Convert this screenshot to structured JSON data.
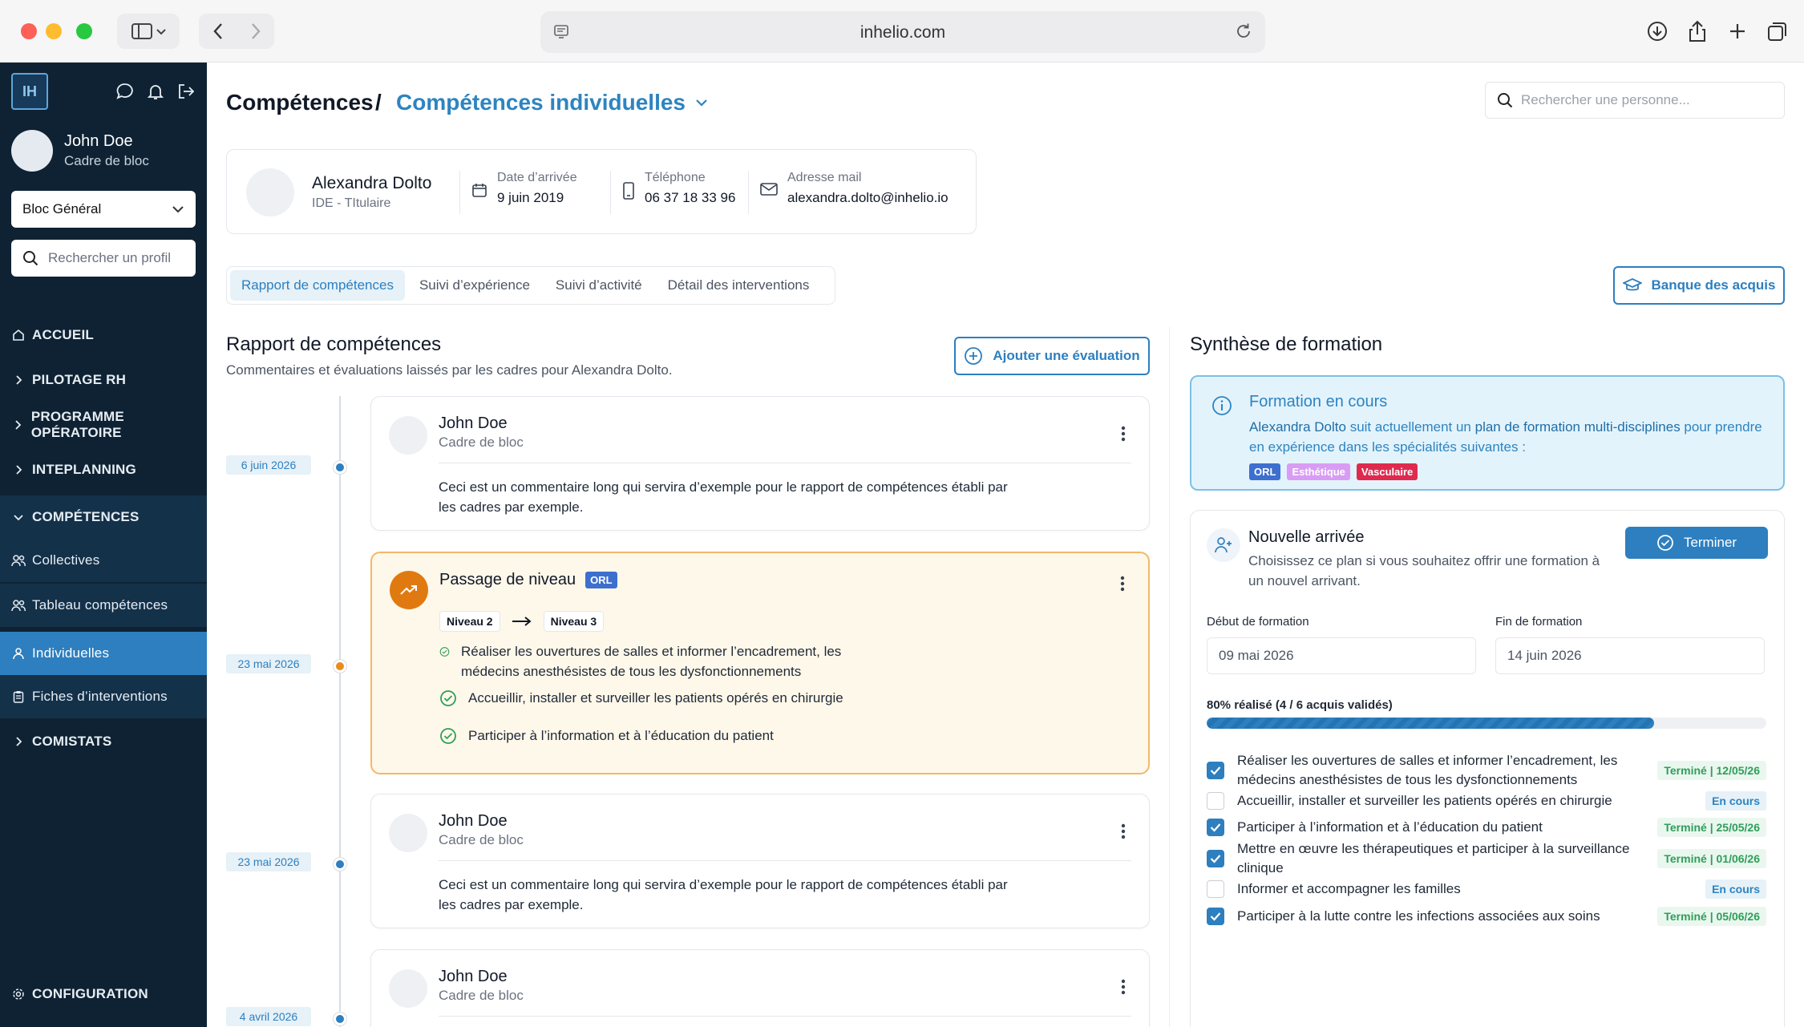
{
  "browser": {
    "url": "inhelio.com"
  },
  "sidebar": {
    "logo": "IH",
    "user": {
      "name": "John Doe",
      "role": "Cadre de bloc"
    },
    "bloc_select": "Bloc Général",
    "search_placeholder": "Rechercher un profil",
    "nav": [
      {
        "label": "ACCUEIL",
        "icon": "home-icon"
      },
      {
        "label": "PILOTAGE RH",
        "icon": "chevron-right-icon"
      },
      {
        "label": "PROGRAMME OPÉRATOIRE",
        "icon": "chevron-right-icon"
      },
      {
        "label": "INTEPLANNING",
        "icon": "chevron-right-icon"
      },
      {
        "label": "COMPÉTENCES",
        "icon": "chevron-down-icon"
      },
      {
        "label": "Collectives",
        "icon": "users-icon"
      },
      {
        "label": "Tableau compétences",
        "icon": "users-icon"
      },
      {
        "label": "Individuelles",
        "icon": "user-icon"
      },
      {
        "label": "Fiches d’interventions",
        "icon": "clipboard-icon"
      },
      {
        "label": "COMISTATS",
        "icon": "chevron-right-icon"
      }
    ],
    "config": "CONFIGURATION"
  },
  "header": {
    "crumb_root": "Compétences",
    "crumb_sep": "/",
    "crumb_current": "Compétences individuelles",
    "search_placeholder": "Rechercher une personne..."
  },
  "profile": {
    "name": "Alexandra Dolto",
    "role": "IDE - TItulaire",
    "arrival_label": "Date d’arrivée",
    "arrival_value": "9 juin 2019",
    "phone_label": "Téléphone",
    "phone_value": "06 37 18 33 96",
    "email_label": "Adresse mail",
    "email_value": "alexandra.dolto@inhelio.io"
  },
  "tabs": [
    {
      "label": "Rapport de compétences"
    },
    {
      "label": "Suivi d’expérience"
    },
    {
      "label": "Suivi d’activité"
    },
    {
      "label": "Détail des interventions"
    }
  ],
  "banque_label": "Banque des acquis",
  "report": {
    "title": "Rapport de compétences",
    "subtitle": "Commentaires et évaluations laissés par les cadres pour Alexandra Dolto.",
    "add_label": "Ajouter une évaluation",
    "dates": [
      "6 juin 2026",
      "23 mai 2026",
      "23 mai 2026",
      "4 avril 2026"
    ],
    "comments": [
      {
        "name": "John Doe",
        "role": "Cadre de bloc",
        "text": "Ceci est un commentaire long qui servira d’exemple pour le rapport de compétences établi par les cadres par exemple."
      },
      {
        "name": "John Doe",
        "role": "Cadre de bloc",
        "text": "Ceci est un commentaire long qui servira d’exemple pour le rapport de compétences établi par les cadres par exemple."
      },
      {
        "name": "John Doe",
        "role": "Cadre de bloc"
      }
    ],
    "level_up": {
      "title": "Passage de niveau",
      "tag": "ORL",
      "from": "Niveau 2",
      "to": "Niveau 3",
      "items": [
        "Réaliser les ouvertures de salles et informer l’encadrement, les médecins anesthésistes de tous les dysfonctionnements",
        "Accueillir, installer et surveiller les patients opérés en chirurgie",
        "Participer à l’information et à l’éducation du patient"
      ]
    }
  },
  "synthese": {
    "title": "Synthèse de formation",
    "info": {
      "title": "Formation en cours",
      "name": "Alexandra Dolto",
      "text_mid": " suit actuellement un ",
      "plan": "plan de formation multi-disciplines",
      "text_end": " pour prendre en expérience dans les spécialités suivantes :",
      "tags": [
        "ORL",
        "Esthétique",
        "Vasculaire"
      ]
    },
    "plan": {
      "title": "Nouvelle arrivée",
      "subtitle": "Choisissez ce plan si vous souhaitez offrir une formation à un nouvel arrivant.",
      "button": "Terminer",
      "start_label": "Début de formation",
      "start_value": "09 mai 2026",
      "end_label": "Fin de formation",
      "end_value": "14 juin 2026",
      "progress_label": "80% réalisé (4 / 6 acquis validés)",
      "progress": 0.8,
      "tasks": [
        {
          "text": "Réaliser les ouvertures de salles et informer l’encadrement, les médecins anesthésistes de tous les dysfonctionnements",
          "checked": true,
          "status": "Terminé | 12/05/26"
        },
        {
          "text": "Accueillir, installer et surveiller les patients opérés en chirurgie",
          "checked": false,
          "status": "En cours"
        },
        {
          "text": "Participer à l’information et à l’éducation du patient",
          "checked": true,
          "status": "Terminé | 25/05/26"
        },
        {
          "text": "Mettre en œuvre les thérapeutiques et participer à la surveillance clinique",
          "checked": true,
          "status": "Terminé | 01/06/26"
        },
        {
          "text": "Informer et accompagner les familles",
          "checked": false,
          "status": "En cours"
        },
        {
          "text": "Participer à la lutte contre les infections associées aux soins",
          "checked": true,
          "status": "Terminé | 05/06/26"
        }
      ]
    }
  },
  "colors": {
    "accent": "#2d7fbf",
    "sidebar_bg": "#0f2233",
    "level_card_bg": "#fef8ea",
    "level_card_border": "#f3b868",
    "done_green": "#2f9e5a"
  }
}
